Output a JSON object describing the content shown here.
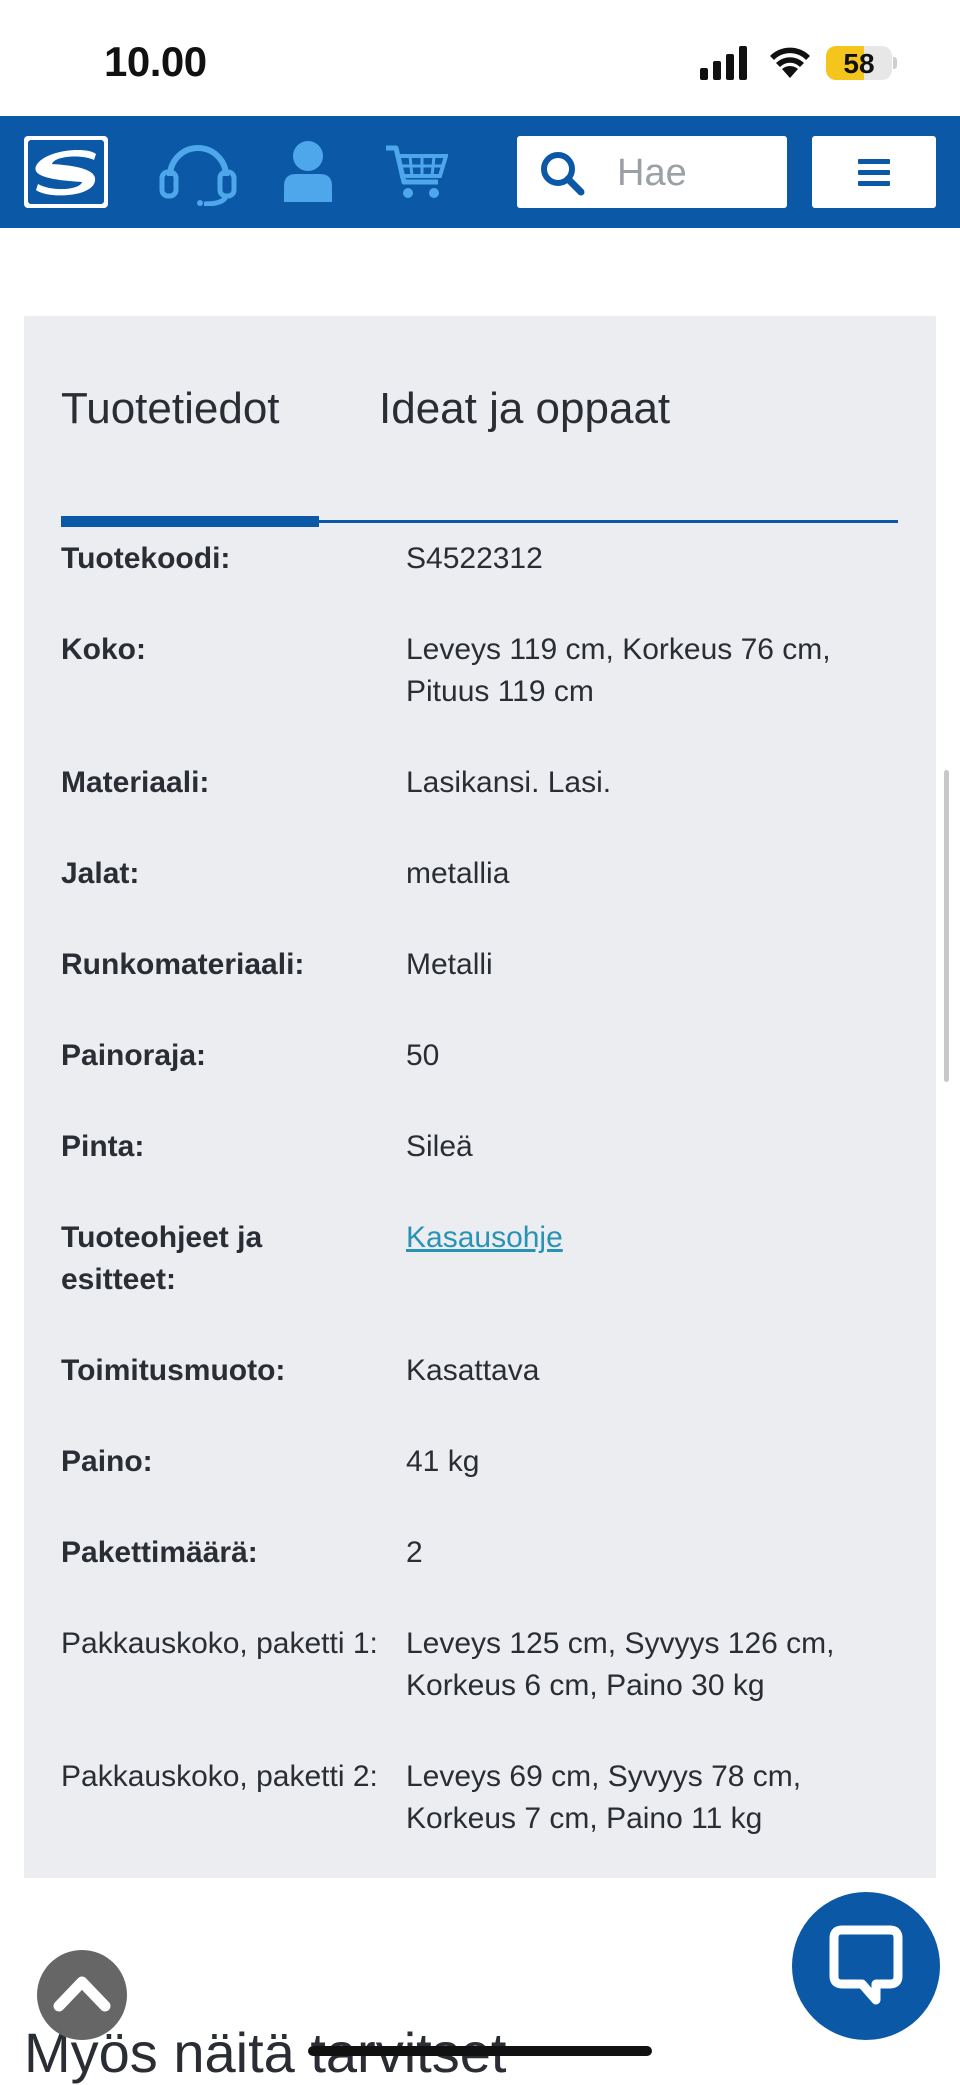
{
  "status_bar": {
    "time": "10.00",
    "battery_level": "58",
    "battery_percent": 58
  },
  "header": {
    "logo_icon": "s-group-logo",
    "icons": [
      "headset-icon",
      "user-icon",
      "cart-icon"
    ],
    "search": {
      "placeholder": "Hae",
      "icon": "search-icon"
    },
    "menu_icon": "hamburger-menu-icon"
  },
  "tabs": [
    {
      "label": "Tuotetiedot",
      "active": true
    },
    {
      "label": "Ideat ja oppaat",
      "active": false
    }
  ],
  "details": [
    {
      "key": "Tuotekoodi:",
      "value": "S4522312",
      "bold": true
    },
    {
      "key": "Koko:",
      "value": "Leveys 119 cm, Korkeus 76 cm, Pituus 119 cm",
      "bold": true
    },
    {
      "key": "Materiaali:",
      "value": "Lasikansi. Lasi.",
      "bold": true
    },
    {
      "key": "Jalat:",
      "value": "metallia",
      "bold": true
    },
    {
      "key": "Runkomateriaali:",
      "value": "Metalli",
      "bold": true
    },
    {
      "key": "Painoraja:",
      "value": "50",
      "bold": true
    },
    {
      "key": "Pinta:",
      "value": "Sileä",
      "bold": true
    },
    {
      "key": "Tuoteohjeet ja esitteet:",
      "value": "Kasausohje",
      "bold": true,
      "link": true
    },
    {
      "key": "Toimitusmuoto:",
      "value": "Kasattava",
      "bold": true
    },
    {
      "key": "Paino:",
      "value": "41 kg",
      "bold": true
    },
    {
      "key": "Pakettimäärä:",
      "value": "2",
      "bold": true
    },
    {
      "key": "Pakkauskoko, paketti 1:",
      "value": "Leveys 125 cm, Syvyys 126 cm, Korkeus 6 cm, Paino 30 kg",
      "bold": false
    },
    {
      "key": "Pakkauskoko, paketti 2:",
      "value": "Leveys 69 cm, Syvyys 78 cm, Korkeus 7 cm, Paino 11 kg",
      "bold": false
    }
  ],
  "next_section": {
    "heading": "Myös näitä tarvitset"
  },
  "floating": {
    "scroll_top_icon": "chevron-up-icon",
    "chat_icon": "chat-bubble-icon"
  },
  "colors": {
    "brand_blue": "#0a58a6",
    "panel_bg": "#ebedf1",
    "link": "#2a93b5"
  }
}
